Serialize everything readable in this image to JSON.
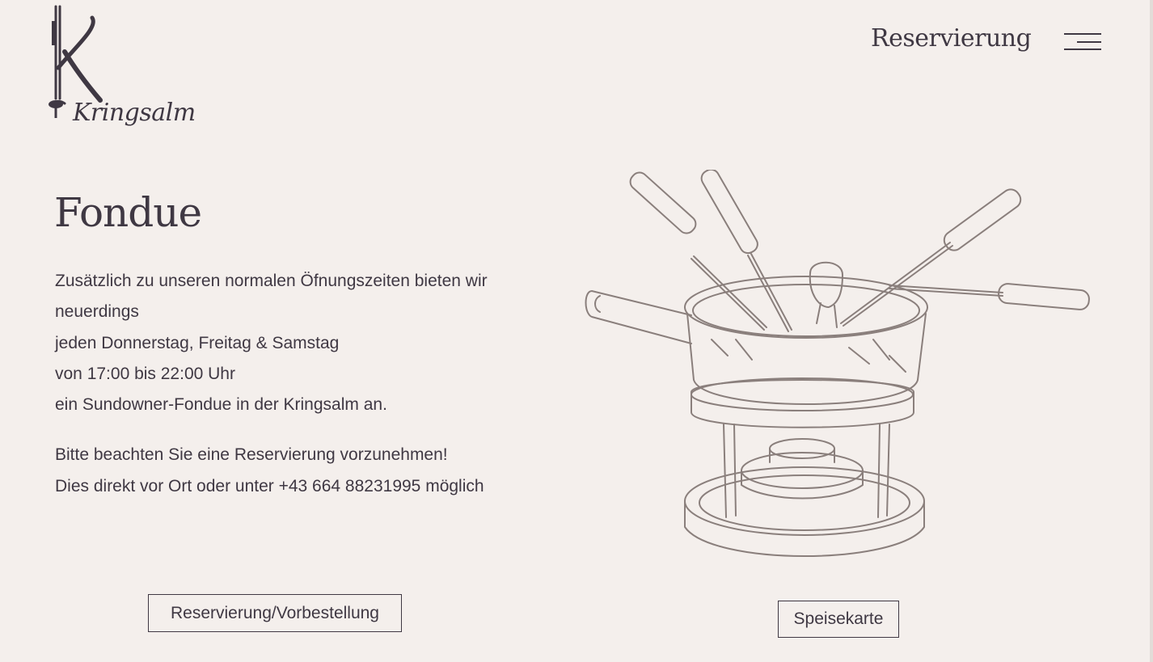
{
  "header": {
    "logo_text": "Kringsalm",
    "logo_icon": "fondue-fork-k-logo",
    "nav_reservation_label": "Reservierung",
    "menu_icon": "hamburger-menu-icon"
  },
  "main": {
    "title": "Fondue",
    "paragraph_1": [
      "Zusätzlich zu unseren normalen Öfnungszeiten bieten wir neuerdings",
      "jeden Donnerstag, Freitag & Samstag",
      "von 17:00 bis 22:00 Uhr",
      "ein Sundowner-Fondue in der Kringsalm an."
    ],
    "paragraph_2": [
      "Bitte beachten Sie eine Reservierung vorzunehmen!",
      "Dies direkt vor Ort oder unter +43 664 88231995 möglich"
    ],
    "illustration_icon": "fondue-pot-illustration"
  },
  "buttons": {
    "reservation_label": "Reservierung/Vorbestellung",
    "menu_label": "Speisekarte"
  },
  "colors": {
    "background": "#f4efec",
    "text": "#3f3843",
    "illustration": "#8a7f7c"
  }
}
